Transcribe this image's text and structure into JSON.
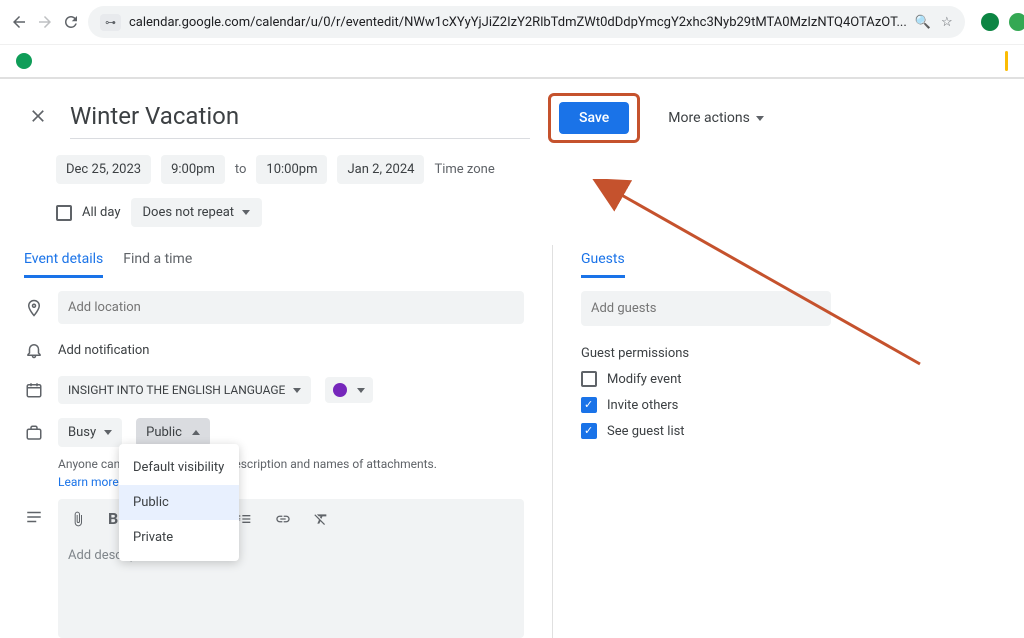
{
  "browser": {
    "url": "calendar.google.com/calendar/u/0/r/eventedit/NWw1cXYyYjJiZ2IzY2RlbTdmZWt0dDdpYmcgY2xhc3Nyb29tMTA0MzIzNTQ4OTAzOT..."
  },
  "event": {
    "title": "Winter Vacation",
    "start_date": "Dec 25, 2023",
    "start_time": "9:00pm",
    "to": "to",
    "end_time": "10:00pm",
    "end_date": "Jan 2, 2024",
    "timezone": "Time zone",
    "all_day": "All day",
    "repeat": "Does not repeat"
  },
  "actions": {
    "save": "Save",
    "more": "More actions"
  },
  "tabs": {
    "details": "Event details",
    "findtime": "Find a time",
    "guests": "Guests"
  },
  "details": {
    "location_ph": "Add location",
    "add_notification": "Add notification",
    "calendar_name": "INSIGHT INTO THE ENGLISH LANGUAGE",
    "busy": "Busy",
    "visibility": "Public",
    "vis_help": "Anyone can s                     ails, including the description and names of attachments.",
    "learn_more": "Learn more a",
    "desc_ph": "Add description"
  },
  "visibility_menu": {
    "default": "Default visibility",
    "public": "Public",
    "private": "Private"
  },
  "guests": {
    "add_ph": "Add guests",
    "perm_title": "Guest permissions",
    "modify": "Modify event",
    "invite": "Invite others",
    "seelist": "See guest list"
  }
}
